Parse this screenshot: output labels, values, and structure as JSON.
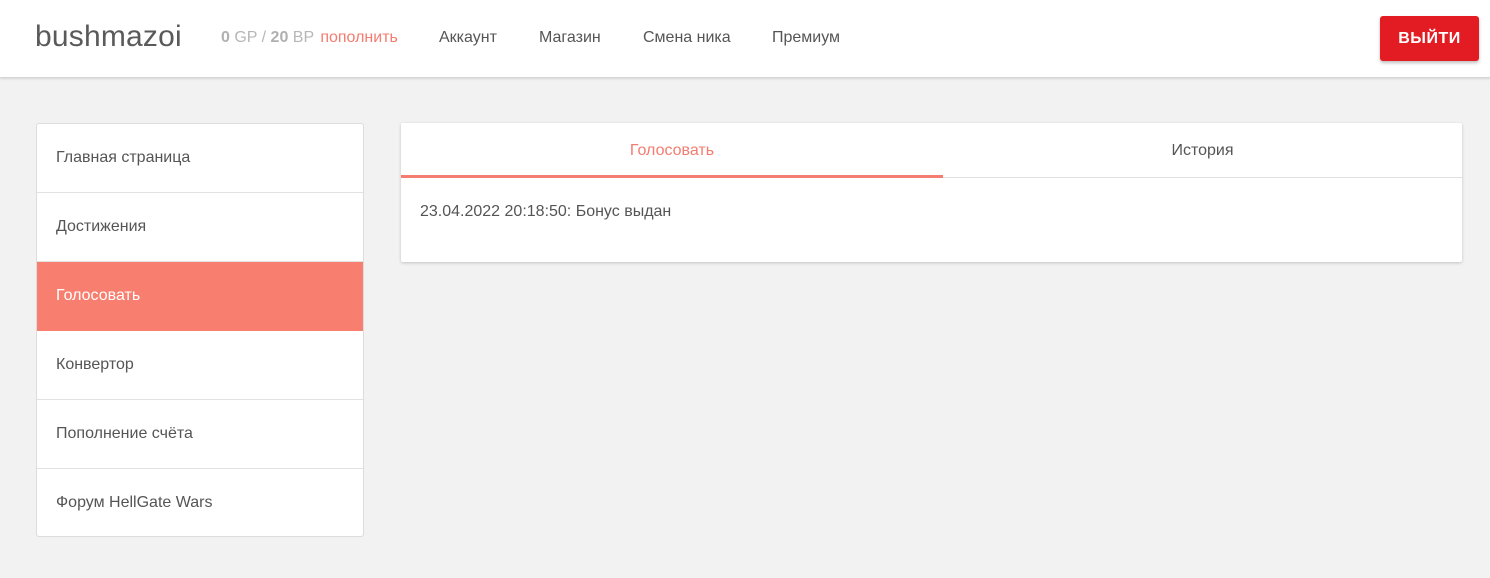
{
  "header": {
    "username": "bushmazoi",
    "balance": {
      "gp_value": "0",
      "gp_unit": "GP",
      "separator": "/",
      "bp_value": "20",
      "bp_unit": "BP",
      "topup_link": "пополнить"
    },
    "nav": [
      "Аккаунт",
      "Магазин",
      "Смена ника",
      "Премиум"
    ],
    "logout_label": "ВЫЙТИ"
  },
  "sidebar": {
    "items": [
      {
        "label": "Главная страница",
        "active": false
      },
      {
        "label": "Достижения",
        "active": false
      },
      {
        "label": "Голосовать",
        "active": true
      },
      {
        "label": "Конвертор",
        "active": false
      },
      {
        "label": "Пополнение счёта",
        "active": false
      },
      {
        "label": "Форум HellGate Wars",
        "active": false
      }
    ]
  },
  "main": {
    "tabs": [
      {
        "label": "Голосовать",
        "active": true
      },
      {
        "label": "История",
        "active": false
      }
    ],
    "log": [
      "23.04.2022 20:18:50: Бонус выдан"
    ]
  },
  "colors": {
    "accent": "#f47c70",
    "active_item_bg": "#f87f6f",
    "logout_bg": "#e31b23",
    "page_bg": "#f2f2f2"
  }
}
